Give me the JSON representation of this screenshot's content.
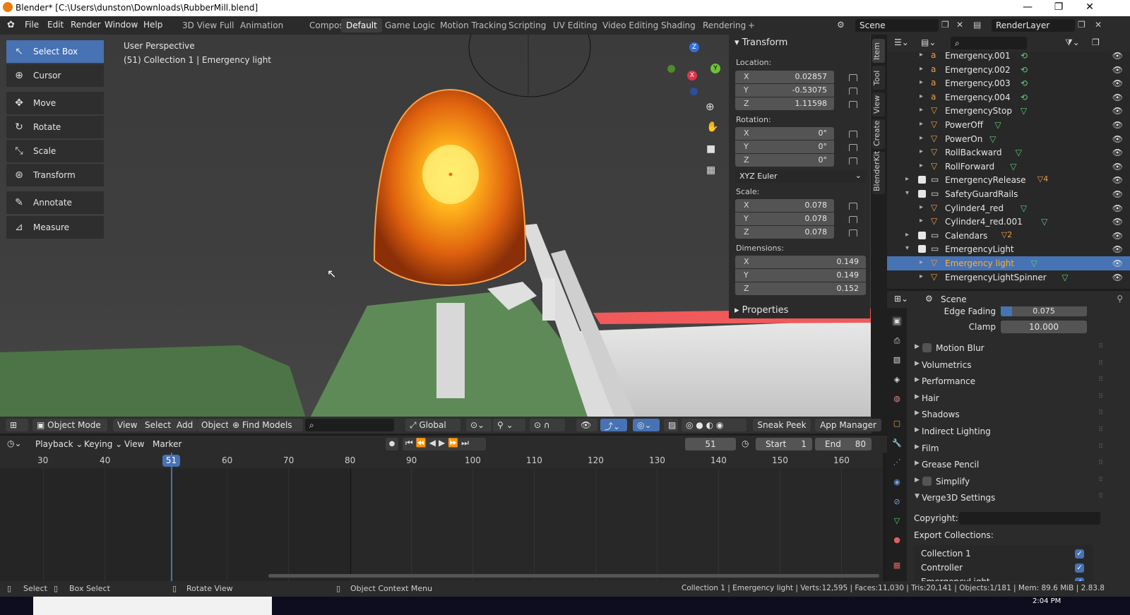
{
  "window": {
    "title": "Blender* [C:\\Users\\dunston\\Downloads\\RubberMill.blend]",
    "min": "—",
    "max": "❐",
    "close": "✕"
  },
  "menu": [
    "File",
    "Edit",
    "Render",
    "Window",
    "Help"
  ],
  "workspaces": [
    "3D View Full",
    "Animation",
    "Compositing",
    "Default",
    "Game Logic",
    "Motion Tracking",
    "Scripting",
    "UV Editing",
    "Video Editing",
    "Shading",
    "Rendering"
  ],
  "active_workspace": "Default",
  "add_workspace": "+",
  "scene": {
    "name": "Scene",
    "render_layer": "RenderLayer"
  },
  "viewport": {
    "perspective": "User Perspective",
    "object_info": "(51) Collection 1 | Emergency light",
    "gizmo": {
      "x": "X",
      "y": "Y",
      "z": "Z"
    }
  },
  "tools": [
    {
      "label": "Select Box",
      "icon": "select-box-icon",
      "glyph": "↖",
      "active": true
    },
    {
      "label": "Cursor",
      "icon": "cursor-icon",
      "glyph": "⊕"
    },
    {
      "label": "Move",
      "icon": "move-icon",
      "glyph": "✥"
    },
    {
      "label": "Rotate",
      "icon": "rotate-icon",
      "glyph": "↻"
    },
    {
      "label": "Scale",
      "icon": "scale-icon",
      "glyph": "⤡"
    },
    {
      "label": "Transform",
      "icon": "transform-icon",
      "glyph": "⊛"
    },
    {
      "label": "Annotate",
      "icon": "annotate-icon",
      "glyph": "✎"
    },
    {
      "label": "Measure",
      "icon": "measure-icon",
      "glyph": "📐"
    }
  ],
  "npanel": {
    "section": "Transform",
    "location_label": "Location:",
    "location": {
      "x": "0.02857",
      "y": "-0.53075",
      "z": "1.11598"
    },
    "rotation_label": "Rotation:",
    "rotation": {
      "x": "0°",
      "y": "0°",
      "z": "0°"
    },
    "rotation_mode": "XYZ Euler",
    "scale_label": "Scale:",
    "scale": {
      "x": "0.078",
      "y": "0.078",
      "z": "0.078"
    },
    "dimensions_label": "Dimensions:",
    "dimensions": {
      "x": "0.149",
      "y": "0.149",
      "z": "0.152"
    },
    "properties_section": "Properties",
    "axis": {
      "x": "X",
      "y": "Y",
      "z": "Z"
    },
    "tabs": [
      "Item",
      "Tool",
      "View",
      "Create",
      "BlenderKit"
    ]
  },
  "viewport_header": {
    "mode": "Object Mode",
    "view": "View",
    "select": "Select",
    "add": "Add",
    "object": "Object",
    "find_models": "Find Models",
    "orientation": "Global",
    "sneak_peek": "Sneak Peek",
    "app_manager": "App Manager"
  },
  "timeline": {
    "playback": "Playback",
    "keying": "Keying",
    "view": "View",
    "marker": "Marker",
    "current_frame": "51",
    "start_label": "Start",
    "start": "1",
    "end_label": "End",
    "end": "80",
    "ticks": [
      "30",
      "40",
      "50",
      "60",
      "70",
      "80",
      "90",
      "100",
      "110",
      "120",
      "130",
      "140",
      "150",
      "160"
    ],
    "playhead": "51"
  },
  "outliner": {
    "rows": [
      {
        "label": "Emergency.001",
        "type": "font",
        "indent": 1
      },
      {
        "label": "Emergency.002",
        "type": "font",
        "indent": 1
      },
      {
        "label": "Emergency.003",
        "type": "font",
        "indent": 1
      },
      {
        "label": "Emergency.004",
        "type": "font",
        "indent": 1
      },
      {
        "label": "EmergencyStop",
        "type": "mesh",
        "indent": 1
      },
      {
        "label": "PowerOff",
        "type": "mesh",
        "indent": 1
      },
      {
        "label": "PowerOn",
        "type": "mesh",
        "indent": 1
      },
      {
        "label": "RollBackward",
        "type": "mesh",
        "indent": 1
      },
      {
        "label": "RollForward",
        "type": "mesh",
        "indent": 1
      },
      {
        "label": "EmergencyRelease",
        "type": "collection",
        "indent": 0,
        "badge": "4"
      },
      {
        "label": "SafetyGuardRails",
        "type": "collection",
        "indent": 0,
        "expanded": true
      },
      {
        "label": "Cylinder4_red",
        "type": "mesh",
        "indent": 1
      },
      {
        "label": "Cylinder4_red.001",
        "type": "mesh",
        "indent": 1
      },
      {
        "label": "Calendars",
        "type": "collection",
        "indent": 0,
        "badge": "2"
      },
      {
        "label": "EmergencyLight",
        "type": "collection",
        "indent": 0,
        "expanded": true
      },
      {
        "label": "Emergency light",
        "type": "mesh",
        "indent": 1,
        "selected": true
      },
      {
        "label": "EmergencyLightSpinner",
        "type": "mesh",
        "indent": 1
      }
    ]
  },
  "properties": {
    "context": "Scene",
    "edge_fading_label": "Edge Fading",
    "edge_fading": "0.075",
    "clamp_label": "Clamp",
    "clamp": "10.000",
    "sections": [
      {
        "label": "Motion Blur",
        "checkbox": true
      },
      {
        "label": "Volumetrics"
      },
      {
        "label": "Performance"
      },
      {
        "label": "Hair"
      },
      {
        "label": "Shadows"
      },
      {
        "label": "Indirect Lighting"
      },
      {
        "label": "Film"
      },
      {
        "label": "Grease Pencil"
      },
      {
        "label": "Simplify",
        "checkbox": true
      },
      {
        "label": "Verge3D Settings",
        "expanded": true
      }
    ],
    "copyright_label": "Copyright:",
    "export_collections_label": "Export Collections:",
    "collections": [
      {
        "label": "Collection 1",
        "checked": true
      },
      {
        "label": "Controller",
        "checked": true
      },
      {
        "label": "EmergencyLight",
        "checked": true
      }
    ]
  },
  "statusbar": {
    "select": "Select",
    "box_select": "Box Select",
    "rotate_view": "Rotate View",
    "context_menu": "Object Context Menu",
    "stats": "Collection 1 | Emergency light | Verts:12,595 | Faces:11,030 | Tris:20,141 | Objects:1/181 | Mem: 89.6 MiB | 2.83.8"
  },
  "taskbar": {
    "time": "2:04 PM"
  },
  "colors": {
    "accent": "#4772b3",
    "orange": "#e87d0d",
    "panel": "#2b2b2b"
  }
}
